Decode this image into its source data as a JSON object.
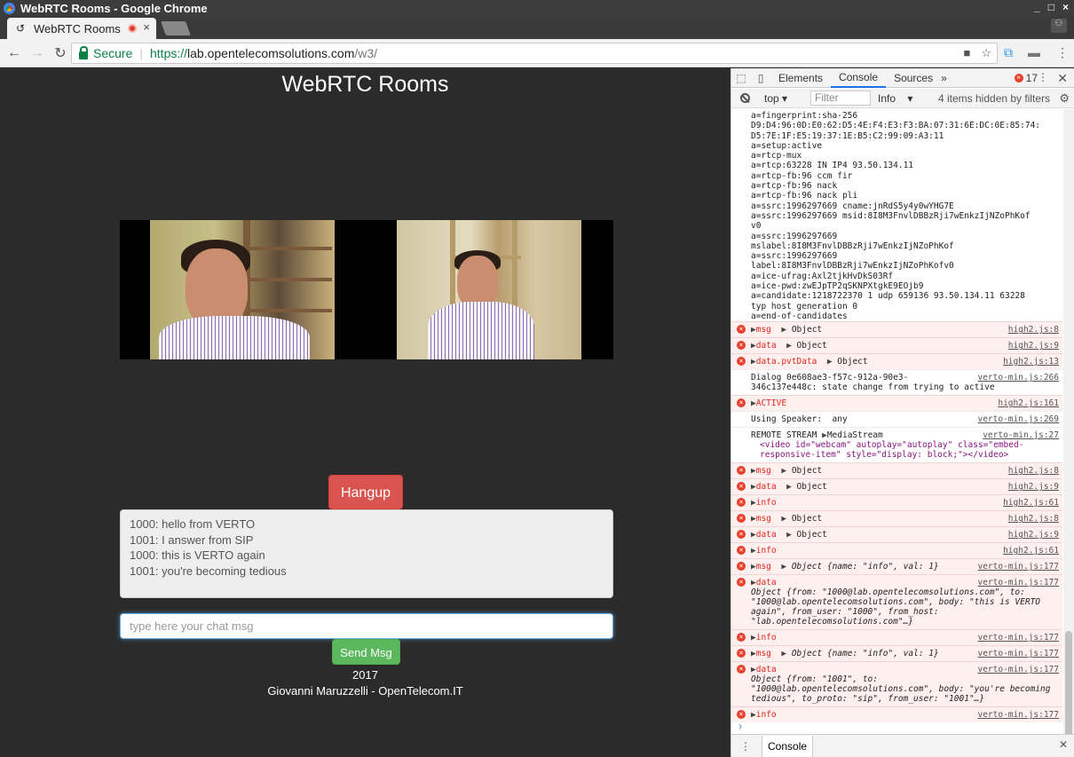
{
  "window": {
    "title": "WebRTC Rooms - Google Chrome",
    "controls": [
      "_",
      "□",
      "×"
    ]
  },
  "tab": {
    "title": "WebRTC Rooms",
    "close": "×"
  },
  "omnibox": {
    "secure_label": "Secure",
    "url_scheme": "https://",
    "url_host": "lab.opentelecomsolutions.com",
    "url_path": "/w3/"
  },
  "page": {
    "title": "WebRTC Rooms",
    "hangup_label": "Hangup",
    "chat_lines": [
      "1000: hello from VERTO",
      "1001: I answer from SIP",
      "1000: this is VERTO again",
      "1001: you're becoming tedious"
    ],
    "chat_placeholder": "type here your chat msg",
    "send_label": "Send Msg",
    "year": "2017",
    "author": "Giovanni Maruzzelli - OpenTelecom.IT"
  },
  "devtools": {
    "tabs": [
      "Elements",
      "Console",
      "Sources"
    ],
    "active_tab": "Console",
    "more": "»",
    "error_count": "17",
    "context": "top",
    "filter_placeholder": "Filter",
    "level": "Info",
    "hidden_note": "4 items hidden by filters",
    "drawer_tab": "Console",
    "sdp_lines": [
      "a=fingerprint:sha-256",
      "D9:D4:96:0D:E0:62:D5:4E:F4:E3:F3:BA:07:31:6E:DC:0E:85:74:",
      "D5:7E:1F:E5:19:37:1E:B5:C2:99:09:A3:11",
      "a=setup:active",
      "a=rtcp-mux",
      "a=rtcp:63228 IN IP4 93.50.134.11",
      "a=rtcp-fb:96 ccm fir",
      "a=rtcp-fb:96 nack",
      "a=rtcp-fb:96 nack pli",
      "a=ssrc:1996297669 cname:jnRdS5y4y0wYHG7E",
      "a=ssrc:1996297669 msid:8I8M3FnvlDBBzRji7wEnkzIjNZoPhKof",
      "v0",
      "a=ssrc:1996297669",
      "mslabel:8I8M3FnvlDBBzRji7wEnkzIjNZoPhKof",
      "a=ssrc:1996297669",
      "label:8I8M3FnvlDBBzRji7wEnkzIjNZoPhKofv0",
      "a=ice-ufrag:Axl2tjkHvDkS03Rf",
      "a=ice-pwd:zwEJpTP2qSKNPXtgkE9EOjb9",
      "a=candidate:1218722370 1 udp 659136 93.50.134.11 63228",
      "typ host generation 0",
      "a=end-of-candidates"
    ],
    "rows": [
      {
        "kind": "err",
        "text": "msg",
        "obj": "Object",
        "src": "high2.js:8"
      },
      {
        "kind": "err",
        "text": "data",
        "obj": "Object",
        "src": "high2.js:9"
      },
      {
        "kind": "err",
        "text": "data.pvtData",
        "obj": "Object",
        "src": "high2.js:13"
      },
      {
        "kind": "log",
        "text": "Dialog 0e608ae3-f57c-912a-90e3-",
        "text2": "346c137e448c: state change from trying to active",
        "src": "verto-min.js:266"
      },
      {
        "kind": "err",
        "text": "ACTIVE",
        "src": "high2.js:161"
      },
      {
        "kind": "log",
        "text": "Using Speaker:  any",
        "src": "verto-min.js:269"
      },
      {
        "kind": "log",
        "text": "REMOTE STREAM",
        "obj": "MediaStream",
        "src": "verto-min.js:27"
      },
      {
        "kind": "err",
        "text": "msg",
        "obj": "Object",
        "src": "high2.js:8"
      },
      {
        "kind": "err",
        "text": "data",
        "obj": "Object",
        "src": "high2.js:9"
      },
      {
        "kind": "err",
        "text": "info",
        "src": "high2.js:61"
      },
      {
        "kind": "err",
        "text": "msg",
        "obj": "Object",
        "src": "high2.js:8"
      },
      {
        "kind": "err",
        "text": "data",
        "obj": "Object",
        "src": "high2.js:9"
      },
      {
        "kind": "err",
        "text": "info",
        "src": "high2.js:61"
      },
      {
        "kind": "err",
        "text": "msg",
        "obj": "Object {name: \"info\", val: 1}",
        "src": "verto-min.js:177"
      },
      {
        "kind": "err",
        "text": "data",
        "src": "verto-min.js:177"
      },
      {
        "kind": "err",
        "text": "info",
        "src": "verto-min.js:177"
      },
      {
        "kind": "err",
        "text": "msg",
        "obj": "Object {name: \"info\", val: 1}",
        "src": "verto-min.js:177"
      },
      {
        "kind": "err",
        "text": "data",
        "src": "verto-min.js:177"
      },
      {
        "kind": "err",
        "text": "info",
        "src": "verto-min.js:177"
      }
    ],
    "video_element": "<video id=\"webcam\" autoplay=\"autoplay\" class=\"embed-responsive-item\" style=\"display: block;\"></video>",
    "data_obj_1": "Object {from: \"1000@lab.opentelecomsolutions.com\", to: \"1000@lab.opentelecomsolutions.com\", body: \"this is VERTO again\", from_user: \"1000\", from_host: \"lab.opentelecomsolutions.com\"…}",
    "data_obj_2": "Object {from: \"1001\", to: \"1000@lab.opentelecomsolutions.com\", body: \"you're becoming tedious\", to_proto: \"sip\", from_user: \"1001\"…}"
  }
}
